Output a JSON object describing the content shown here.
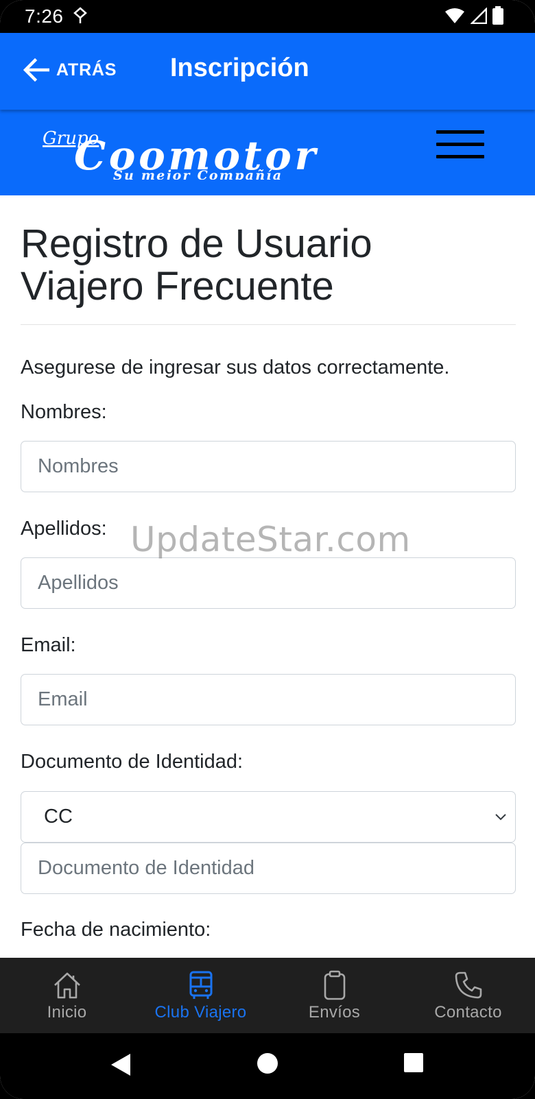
{
  "status_bar": {
    "time": "7:26"
  },
  "header": {
    "back_label": "ATRÁS",
    "title": "Inscripción"
  },
  "brand": {
    "logo_text_top": "Grupo",
    "logo_text_main": "Coomotor",
    "logo_tagline": "Su mejor Compañía"
  },
  "form": {
    "title_line1": "Registro de Usuario",
    "title_line2": "Viajero Frecuente",
    "intro": "Asegurese de ingresar sus datos correctamente.",
    "nombres_label": "Nombres:",
    "nombres_placeholder": "Nombres",
    "apellidos_label": "Apellidos:",
    "apellidos_placeholder": "Apellidos",
    "email_label": "Email:",
    "email_placeholder": "Email",
    "documento_label": "Documento de Identidad:",
    "documento_type": "CC",
    "documento_placeholder": "Documento de Identidad",
    "fecha_label": "Fecha de nacimiento:"
  },
  "watermark": "UpdateStar.com",
  "tabs": [
    {
      "label": "Inicio",
      "icon": "home-icon",
      "active": false
    },
    {
      "label": "Club Viajero",
      "icon": "bus-icon",
      "active": true
    },
    {
      "label": "Envíos",
      "icon": "clipboard-icon",
      "active": false
    },
    {
      "label": "Contacto",
      "icon": "phone-icon",
      "active": false
    }
  ],
  "colors": {
    "primary": "#0a6bfb",
    "tab_active": "#1a73f0",
    "tab_inactive": "#a8a8a8",
    "tab_bar_bg": "#1f1f1f"
  }
}
